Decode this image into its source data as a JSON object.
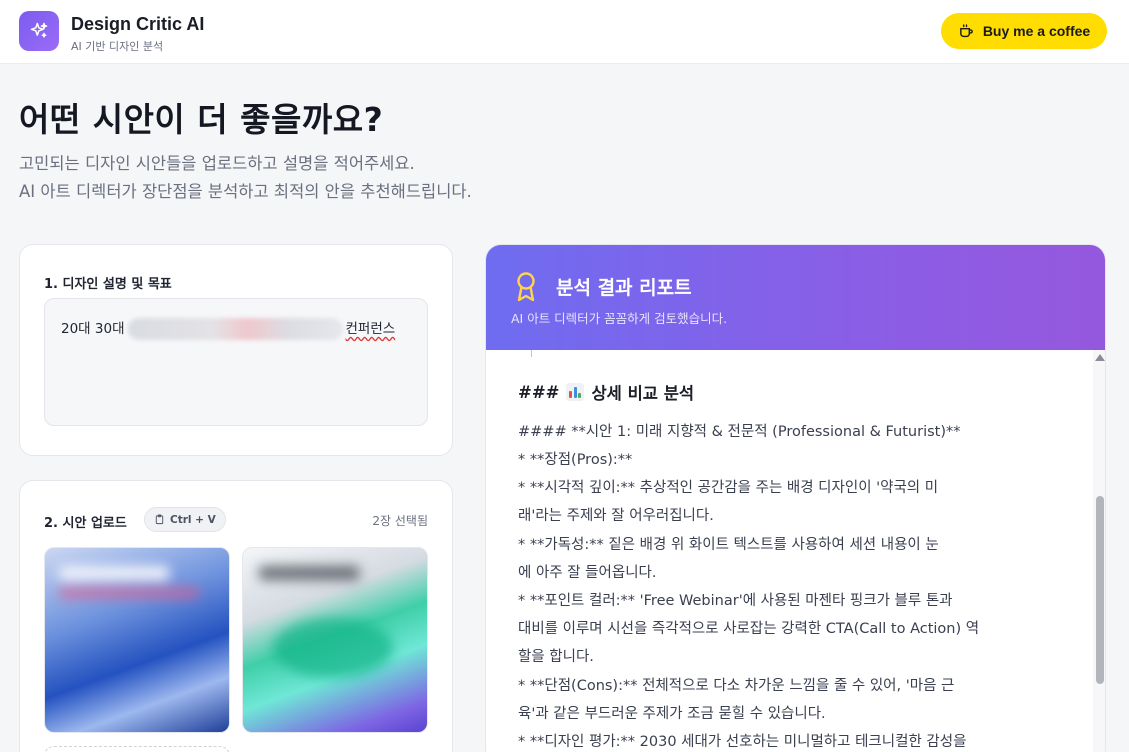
{
  "header": {
    "app_title": "Design Critic AI",
    "app_subtitle": "AI 기반 디자인 분석",
    "coffee_label": "Buy me a coffee"
  },
  "hero": {
    "title": "어떤 시안이 더 좋을까요?",
    "desc_line1": "고민되는 디자인 시안들을 업로드하고 설명을 적어주세요.",
    "desc_line2": "AI 아트 디렉터가 장단점을 분석하고 최적의 안을 추천해드립니다."
  },
  "description_card": {
    "label": "1. 디자인 설명 및 목표",
    "text_start": "20대 30대",
    "text_end": "컨퍼런스"
  },
  "upload_card": {
    "label": "2. 시안 업로드",
    "shortcut": "Ctrl + V",
    "selected_count": "2장 선택됨"
  },
  "report": {
    "title": "분석 결과 리포트",
    "subtitle": "AI 아트 디렉터가 꼼꼼하게 검토했습니다.",
    "heading_prefix": "###",
    "heading_text": "상세 비교 분석",
    "lines": [
      "#### **시안 1: 미래 지향적 & 전문적 (Professional & Futurist)**",
      "*    **장점(Pros):**",
      "     *    **시각적 깊이:** 추상적인 공간감을 주는 배경 디자인이 '약국의 미",
      "래'라는 주제와 잘 어우러집니다.",
      "     *    **가독성:** 짙은 배경 위 화이트 텍스트를 사용하여 세션 내용이 눈",
      "에 아주 잘 들어옵니다.",
      "     *    **포인트 컬러:** 'Free Webinar'에 사용된 마젠타 핑크가 블루 톤과",
      "대비를 이루며 시선을 즉각적으로 사로잡는 강력한 CTA(Call to Action) 역",
      "할을 합니다.",
      "*    **단점(Cons):** 전체적으로 다소 차가운 느낌을 줄 수 있어, '마음 근",
      "육'과 같은 부드러운 주제가 조금 묻힐 수 있습니다.",
      "*    **디자인 평가:** 2030 세대가 선호하는 미니멀하고 테크니컬한 감성을"
    ]
  },
  "colors": {
    "accent_purple": "#8a5ee6",
    "coffee_yellow": "#ffdd00"
  }
}
